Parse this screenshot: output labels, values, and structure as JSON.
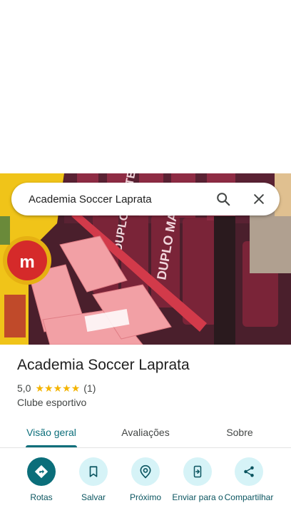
{
  "search": {
    "query": "Academia Soccer Laprata"
  },
  "place": {
    "name": "Academia Soccer Laprata",
    "rating": "5,0",
    "stars": 5,
    "reviews": "(1)",
    "category": "Clube esportivo"
  },
  "tabs": [
    "Visão geral",
    "Avaliações",
    "Sobre"
  ],
  "actions": [
    {
      "label": "Rotas",
      "icon": "directions-icon"
    },
    {
      "label": "Salvar",
      "icon": "bookmark-icon"
    },
    {
      "label": "Próximo",
      "icon": "nearby-icon"
    },
    {
      "label": "Enviar para o",
      "icon": "send-to-phone-icon"
    },
    {
      "label": "Compartilhar",
      "icon": "share-icon"
    }
  ],
  "photo": {
    "labels": [
      "DUPLO MALTE",
      "DUPLO MALTE",
      "m"
    ]
  },
  "colors": {
    "accent": "#0b6e7a",
    "action_bg": "#d6f3f7",
    "star": "#f4b400"
  }
}
